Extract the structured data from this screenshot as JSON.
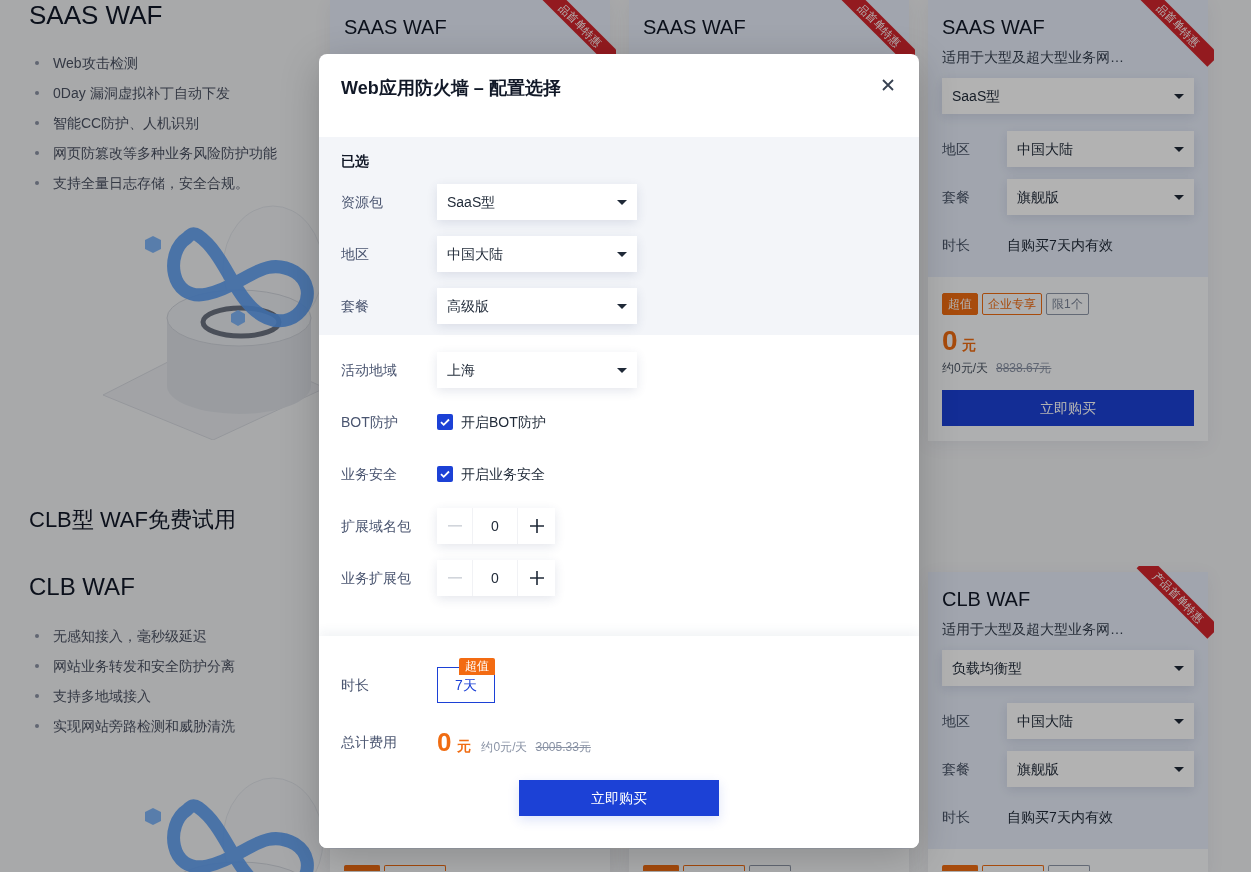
{
  "saas_section": {
    "title": "SAAS WAF",
    "features": [
      "Web攻击检测",
      "0Day 漏洞虚拟补丁自动下发",
      "智能CC防护、人机识别",
      "网页防篡改等多种业务风险防护功能",
      "支持全量日志存储，安全合规。"
    ]
  },
  "top_cards": [
    {
      "ribbon": "品首单特惠",
      "title": "SAAS WAF"
    },
    {
      "ribbon": "品首单特惠",
      "title": "SAAS WAF"
    },
    {
      "ribbon": "品首单特惠",
      "title": "SAAS WAF",
      "subtitle": "适用于大型及超大型业务网…",
      "type_select": "SaaS型",
      "fields": [
        {
          "label": "地区",
          "kind": "select",
          "value": "中国大陆"
        },
        {
          "label": "套餐",
          "kind": "select",
          "value": "旗舰版"
        },
        {
          "label": "时长",
          "kind": "text",
          "value": "自购买7天内有效"
        }
      ],
      "tags": [
        {
          "text": "超值",
          "kind": "filled"
        },
        {
          "text": "企业专享",
          "kind": "outline"
        },
        {
          "text": "限1个",
          "kind": "muted"
        }
      ],
      "price": "0",
      "unit": "元",
      "daily": "约0元/天",
      "original": "8838.67元",
      "button": "立即购买"
    }
  ],
  "clb_section": {
    "heading": "CLB型 WAF免费试用",
    "title": "CLB WAF",
    "features": [
      "无感知接入，毫秒级延迟",
      "网站业务转发和安全防护分离",
      "支持多地域接入",
      "实现网站旁路检测和威胁清洗"
    ]
  },
  "bottom_cards": [
    {
      "tags": [
        {
          "kind": "filled"
        },
        {
          "kind": "outline"
        }
      ]
    },
    {
      "tags": [
        {
          "kind": "filled"
        },
        {
          "kind": "outline"
        },
        {
          "kind": "muted"
        }
      ]
    },
    {
      "ribbon": "产品首单特惠",
      "title": "CLB WAF",
      "subtitle": "适用于大型及超大型业务网…",
      "type_select": "负载均衡型",
      "fields": [
        {
          "label": "地区",
          "kind": "select",
          "value": "中国大陆"
        },
        {
          "label": "套餐",
          "kind": "select",
          "value": "旗舰版"
        },
        {
          "label": "时长",
          "kind": "text",
          "value": "自购买7天内有效"
        }
      ],
      "tags": [
        {
          "kind": "filled"
        },
        {
          "kind": "outline"
        },
        {
          "kind": "muted"
        }
      ]
    }
  ],
  "modal": {
    "title": "Web应用防火墙 – 配置选择",
    "selected_section": {
      "heading": "已选",
      "fields": [
        {
          "label": "资源包",
          "value": "SaaS型"
        },
        {
          "label": "地区",
          "value": "中国大陆"
        },
        {
          "label": "套餐",
          "value": "高级版"
        }
      ]
    },
    "options": [
      {
        "label": "活动地域",
        "kind": "select",
        "value": "上海"
      },
      {
        "label": "BOT防护",
        "kind": "checkbox",
        "text": "开启BOT防护",
        "checked": true
      },
      {
        "label": "业务安全",
        "kind": "checkbox",
        "text": "开启业务安全",
        "checked": true
      },
      {
        "label": "扩展域名包",
        "kind": "stepper",
        "value": "0",
        "decrease_disabled": true
      },
      {
        "label": "业务扩展包",
        "kind": "stepper",
        "value": "0",
        "decrease_disabled": true
      }
    ],
    "duration": {
      "label": "时长",
      "options": [
        {
          "text": "7天",
          "badge": "超值",
          "selected": true
        }
      ]
    },
    "total": {
      "label": "总计费用",
      "price": "0",
      "unit": "元",
      "daily": "约0元/天",
      "original": "3005.33元"
    },
    "submit": "立即购买"
  }
}
